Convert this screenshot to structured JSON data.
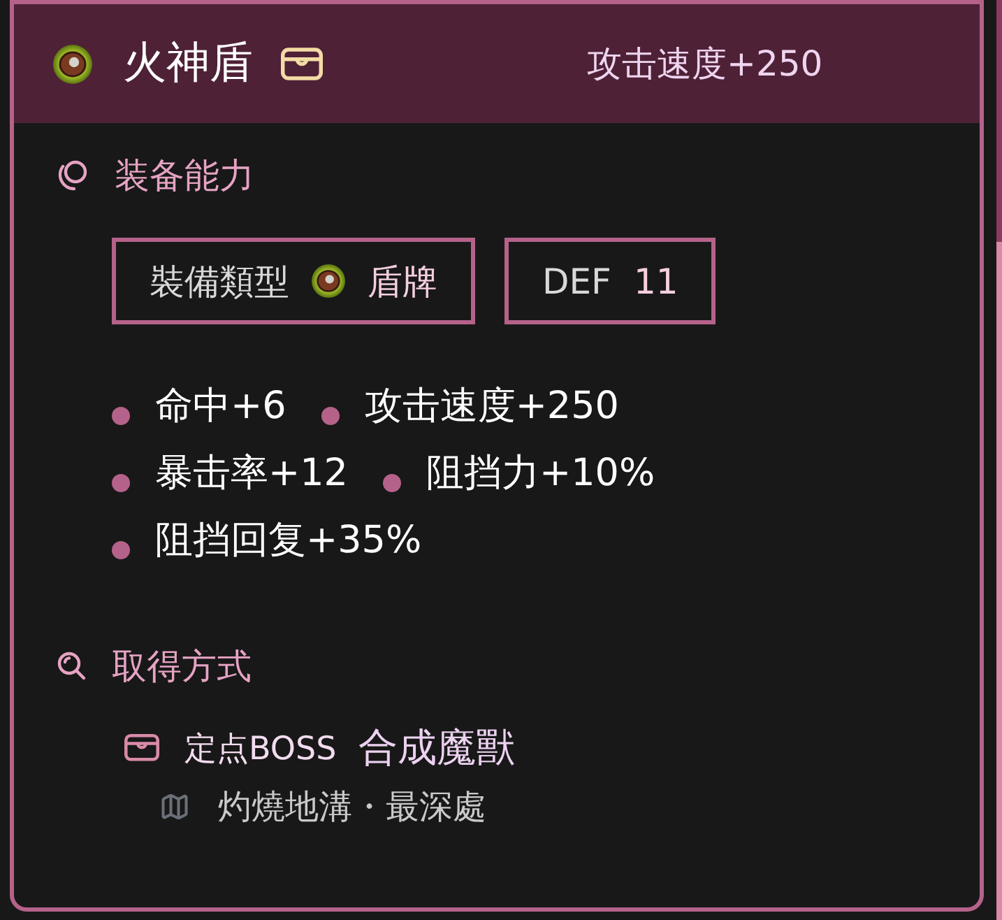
{
  "header": {
    "title": "火神盾",
    "stat": "攻击速度+250"
  },
  "abilities": {
    "title": "装备能力",
    "chips": [
      {
        "kind": "type",
        "label": "裝備類型",
        "value": "盾牌"
      },
      {
        "kind": "stat",
        "label": "DEF",
        "value": "11"
      }
    ],
    "stats": [
      "命中+6",
      "攻击速度+250",
      "暴击率+12",
      "阻挡力+10%",
      "阻挡回复+35%"
    ]
  },
  "acquisition": {
    "title": "取得方式",
    "sources": [
      {
        "type": "定点BOSS",
        "name": "合成魔獸",
        "location": "灼燒地溝・最深處"
      }
    ]
  }
}
